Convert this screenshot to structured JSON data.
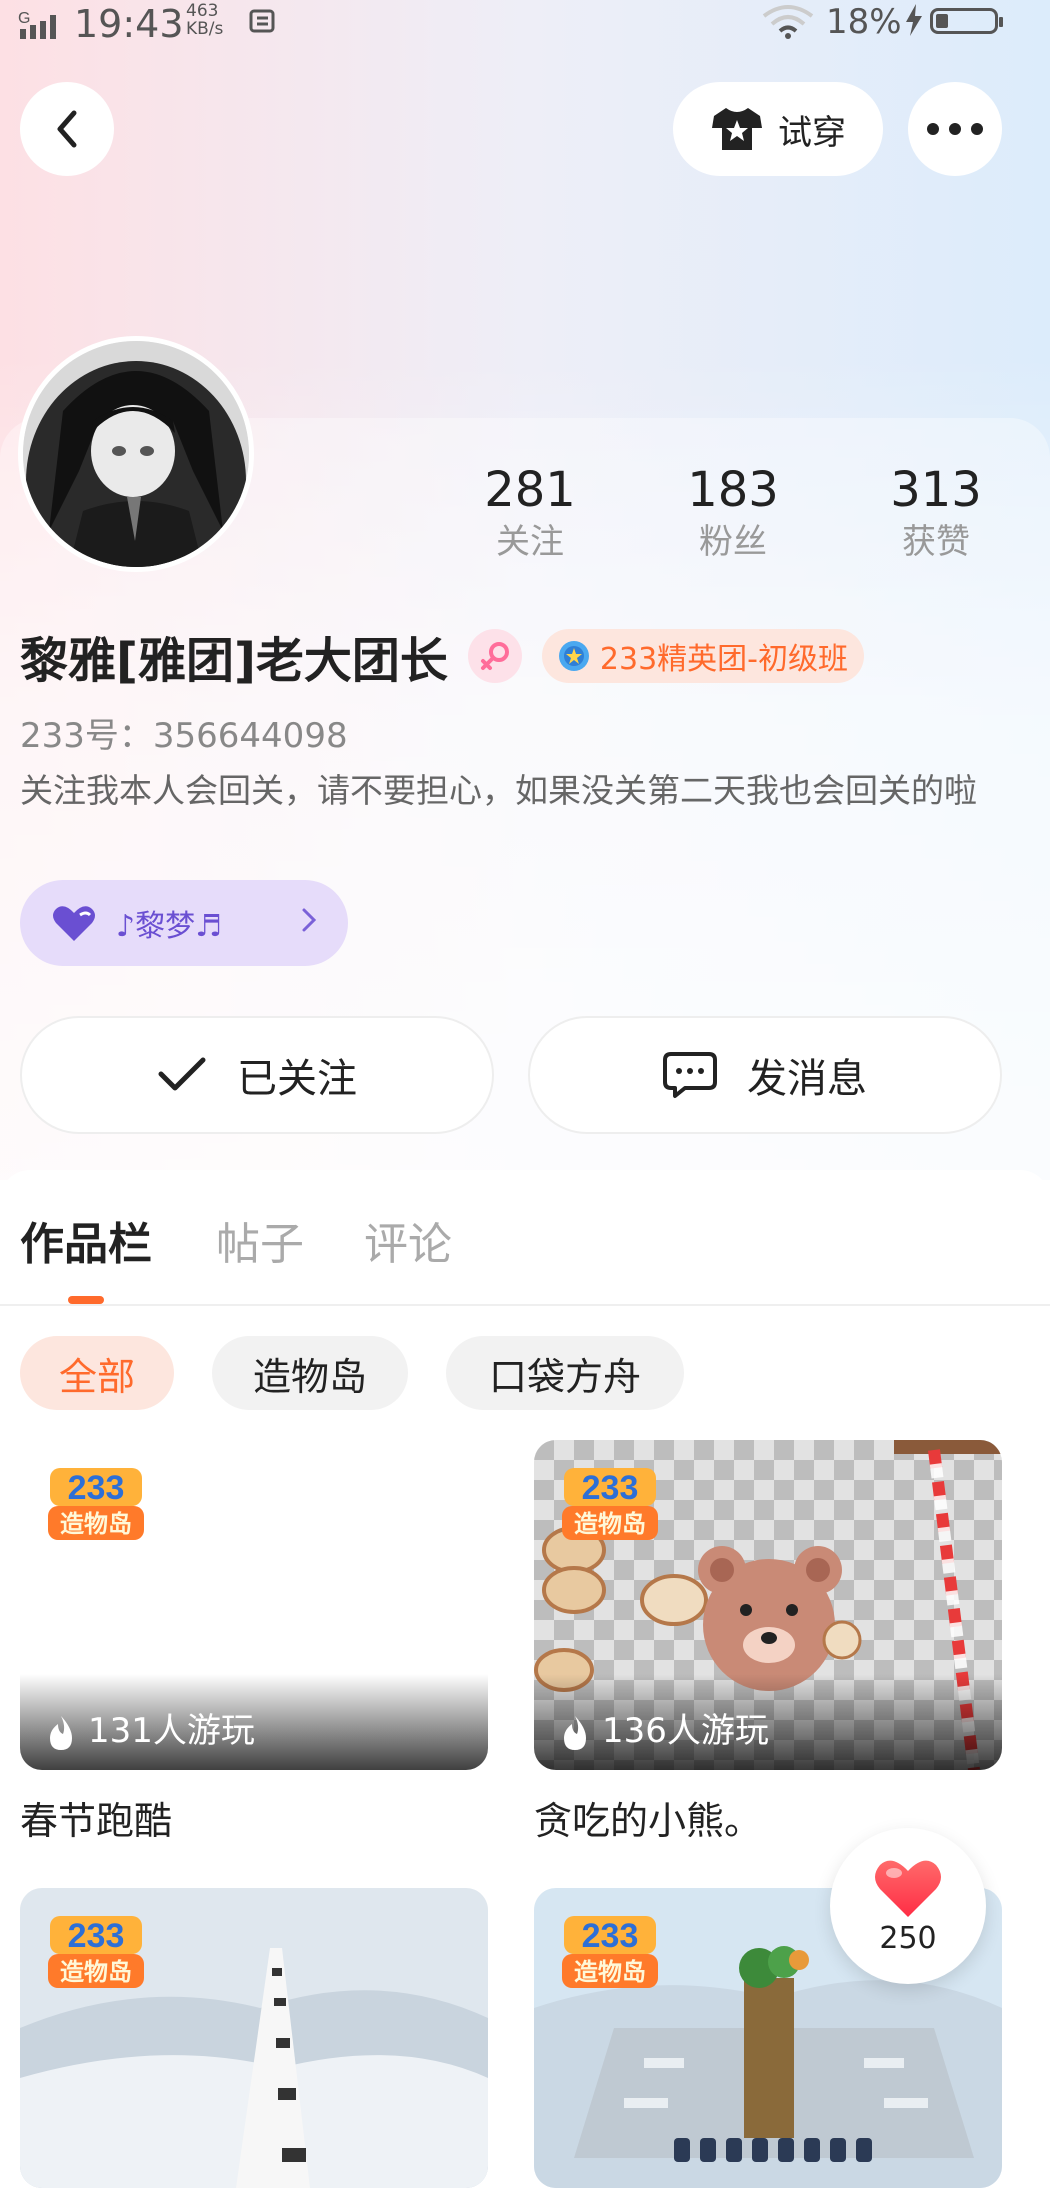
{
  "status_bar": {
    "network": "G",
    "time": "19:43",
    "speed_value": "463",
    "speed_unit": "KB/s",
    "battery": "18%"
  },
  "header": {
    "tryon_label": "试穿"
  },
  "profile": {
    "name": "黎雅[雅团]老大团长",
    "badge": "233精英团-初级班",
    "uid": "233号：356644098",
    "bio": "关注我本人会回关，请不要担心，如果没关第二天我也会回关的啦",
    "music": "♪黎梦♬"
  },
  "stats": [
    {
      "value": "281",
      "label": "关注"
    },
    {
      "value": "183",
      "label": "粉丝"
    },
    {
      "value": "313",
      "label": "获赞"
    }
  ],
  "actions": {
    "followed": "已关注",
    "message": "发消息"
  },
  "tabs": [
    {
      "label": "作品栏"
    },
    {
      "label": "帖子"
    },
    {
      "label": "评论"
    }
  ],
  "filters": [
    {
      "label": "全部"
    },
    {
      "label": "造物岛"
    },
    {
      "label": "口袋方舟"
    }
  ],
  "games": [
    {
      "title": "春节跑酷",
      "plays": "131人游玩"
    },
    {
      "title": "贪吃的小熊。",
      "plays": "136人游玩"
    }
  ],
  "logo_text": {
    "line1": "233",
    "line2": "造物岛"
  },
  "likes": "250",
  "colors": {
    "accent": "#ff6a2c",
    "music_bg": "#e6dcfa",
    "like": "#ff3b4a"
  }
}
